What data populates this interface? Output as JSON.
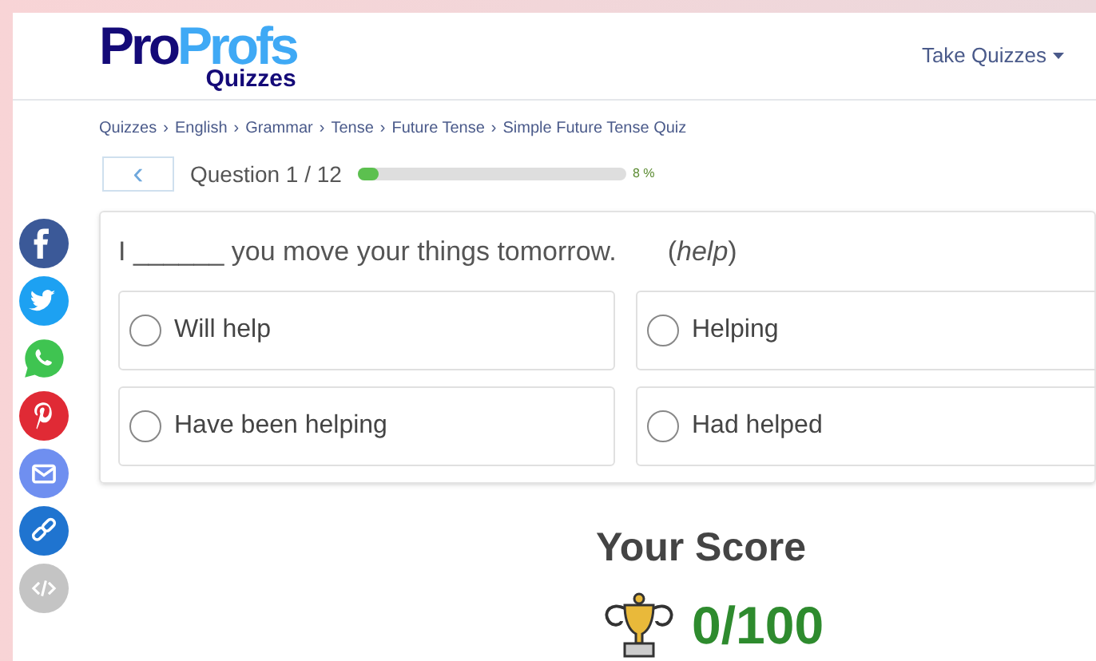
{
  "header": {
    "logo_top_dark": "Pro",
    "logo_top_light": "Profs",
    "logo_bottom": "Quizzes",
    "menu": "Take Quizzes"
  },
  "breadcrumb": [
    "Quizzes",
    "English",
    "Grammar",
    "Tense",
    "Future Tense",
    "Simple Future Tense Quiz"
  ],
  "breadcrumb_separator": "›",
  "progress": {
    "back": "‹",
    "label": "Question 1 / 12",
    "level": 0.08,
    "reading": "8 %"
  },
  "share_buttons": [
    {
      "kind": "facebook"
    },
    {
      "kind": "twitter"
    },
    {
      "kind": "whatsapp"
    },
    {
      "kind": "pinterest"
    },
    {
      "kind": "email"
    },
    {
      "kind": "link"
    },
    {
      "kind": "embed"
    }
  ],
  "question": {
    "text": "I ______ you move your things tomorrow.",
    "hint": "(*help*)",
    "options": [
      {
        "label": "Will help",
        "selected": false
      },
      {
        "label": "Helping",
        "selected": false
      },
      {
        "label": "Have been helping",
        "selected": false
      },
      {
        "label": "Had helped",
        "selected": false
      }
    ]
  },
  "score": {
    "title": "Your Score",
    "value": "0/100"
  }
}
